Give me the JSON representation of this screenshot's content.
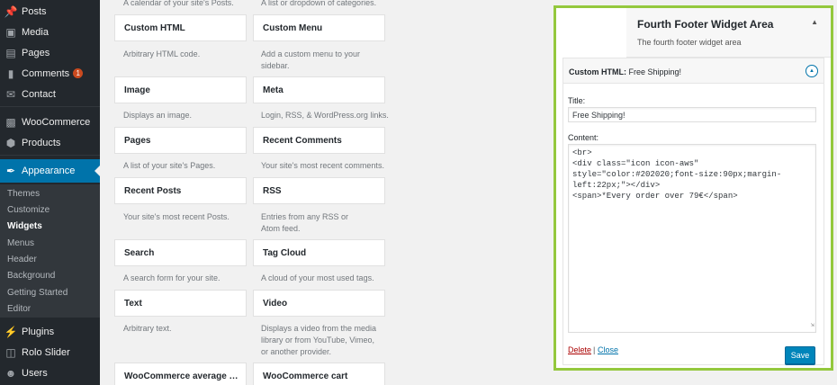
{
  "sidebar": {
    "posts": "Posts",
    "media": "Media",
    "pages": "Pages",
    "comments": "Comments",
    "comments_count": "1",
    "contact": "Contact",
    "woocommerce": "WooCommerce",
    "products": "Products",
    "appearance": "Appearance",
    "submenu": [
      "Themes",
      "Customize",
      "Widgets",
      "Menus",
      "Header",
      "Background",
      "Getting Started",
      "Editor"
    ],
    "plugins": "Plugins",
    "rolo_slider": "Rolo Slider",
    "users": "Users"
  },
  "widgets": {
    "top_left_desc": "A calendar of your site's Posts.",
    "top_right_desc": "A list or dropdown of categories.",
    "items": [
      {
        "title": "Custom HTML",
        "desc": "Arbitrary HTML code."
      },
      {
        "title": "Custom Menu",
        "desc": "Add a custom menu to your sidebar."
      },
      {
        "title": "Image",
        "desc": "Displays an image."
      },
      {
        "title": "Meta",
        "desc": "Login, RSS, & WordPress.org links."
      },
      {
        "title": "Pages",
        "desc": "A list of your site's Pages."
      },
      {
        "title": "Recent Comments",
        "desc": "Your site's most recent comments."
      },
      {
        "title": "Recent Posts",
        "desc": "Your site's most recent Posts."
      },
      {
        "title": "RSS",
        "desc": "Entries from any RSS or Atom feed."
      },
      {
        "title": "Search",
        "desc": "A search form for your site."
      },
      {
        "title": "Tag Cloud",
        "desc": "A cloud of your most used tags."
      },
      {
        "title": "Text",
        "desc": "Arbitrary text."
      },
      {
        "title": "Video",
        "desc": "Displays a video from the media library or from YouTube, Vimeo, or another provider."
      },
      {
        "title": "WooCommerce average rati...",
        "desc": ""
      },
      {
        "title": "WooCommerce cart",
        "desc": ""
      }
    ]
  },
  "area": {
    "title": "Fourth Footer Widget Area",
    "description": "The fourth footer widget area",
    "widget_title_prefix": "Custom HTML:",
    "widget_title_value": "Free Shipping!",
    "title_label": "Title:",
    "title_value": "Free Shipping!",
    "content_label": "Content:",
    "content_value": "<br>\n<div class=\"icon icon-aws\"\nstyle=\"color:#202020;font-size:90px;margin-\nleft:22px;\"></div>\n<span>*Every order over 79€</span>",
    "delete_label": "Delete",
    "separator": "|",
    "close_label": "Close",
    "save_label": "Save"
  },
  "colors": {
    "highlight_border": "#94c83d",
    "admin_blue": "#0073aa",
    "sidebar_bg": "#23282d"
  }
}
